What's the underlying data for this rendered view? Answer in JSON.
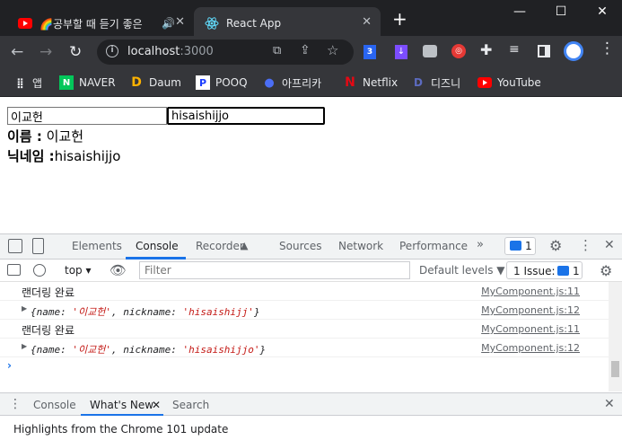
{
  "tabs": [
    {
      "title": "🌈공부할 때 듣기 좋은",
      "icon": "youtube-icon"
    },
    {
      "title": "React App",
      "icon": "react-icon"
    }
  ],
  "window": {
    "minimize": "—",
    "maximize": "☐",
    "close": "✕"
  },
  "address": {
    "host": "localhost",
    "port": ":3000"
  },
  "bookmarks": [
    {
      "label": "앱"
    },
    {
      "label": "NAVER"
    },
    {
      "label": "Daum"
    },
    {
      "label": "POOQ"
    },
    {
      "label": "아프리카"
    },
    {
      "label": "Netflix"
    },
    {
      "label": "디즈니"
    },
    {
      "label": "YouTube"
    }
  ],
  "page": {
    "name_value": "이교헌",
    "nickname_value": "hisaishijjo",
    "name_label": "이름 :",
    "name_text": " 이교헌",
    "nick_label": "닉네임 :",
    "nick_text": "hisaishijjo"
  },
  "devtools": {
    "tabs": [
      "Elements",
      "Console",
      "Recorder",
      "Sources",
      "Network",
      "Performance"
    ],
    "issues_badge": "1",
    "context": "top",
    "filter_placeholder": "Filter",
    "levels": "Default levels ▼",
    "issues_label": "1 Issue:",
    "issues_count": "1",
    "logs": [
      {
        "text": "랜더링 완료",
        "source": "MyComponent.js:11"
      },
      {
        "prefix": "{name: ",
        "name": "'이교헌'",
        "mid": ", nickname: ",
        "nick": "'hisaishijj'",
        "suffix": "}",
        "source": "MyComponent.js:12"
      },
      {
        "text": "랜더링 완료",
        "source": "MyComponent.js:11"
      },
      {
        "prefix": "{name: ",
        "name": "'이교헌'",
        "mid": ", nickname: ",
        "nick": "'hisaishijjo'",
        "suffix": "}",
        "source": "MyComponent.js:12"
      }
    ],
    "drawer_tabs": [
      "Console",
      "What's New",
      "Search"
    ],
    "drawer_text": "Highlights from the Chrome 101 update"
  }
}
